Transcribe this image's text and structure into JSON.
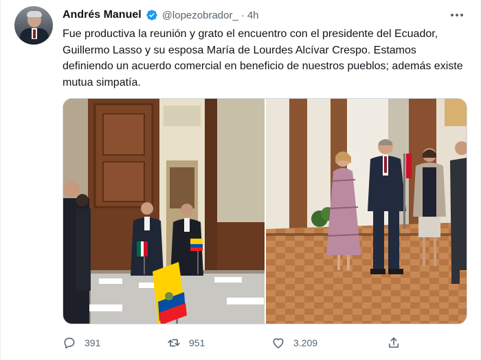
{
  "tweet": {
    "author_name": "Andrés Manuel",
    "handle": "@lopezobrador_",
    "separator": "·",
    "time": "4h",
    "text": "Fue productiva la reunión y grato el encuentro con el presidente del Ecuador, Guillermo Lasso y su esposa María de Lourdes Alcívar Crespo. Estamos definiendo un acuerdo comercial en beneficio de nuestros pueblos; además existe mutua simpatía.",
    "verified": true
  },
  "metrics": {
    "replies": "391",
    "retweets": "951",
    "likes": "3.209"
  },
  "icons": {
    "verified": "verified-badge-icon",
    "more": "more-options-icon",
    "reply": "reply-icon",
    "retweet": "retweet-icon",
    "like": "heart-icon",
    "share": "share-icon"
  },
  "colors": {
    "text_primary": "#0f1419",
    "text_secondary": "#536471",
    "verified_blue": "#1d9bf0",
    "border": "#cfd9de"
  }
}
